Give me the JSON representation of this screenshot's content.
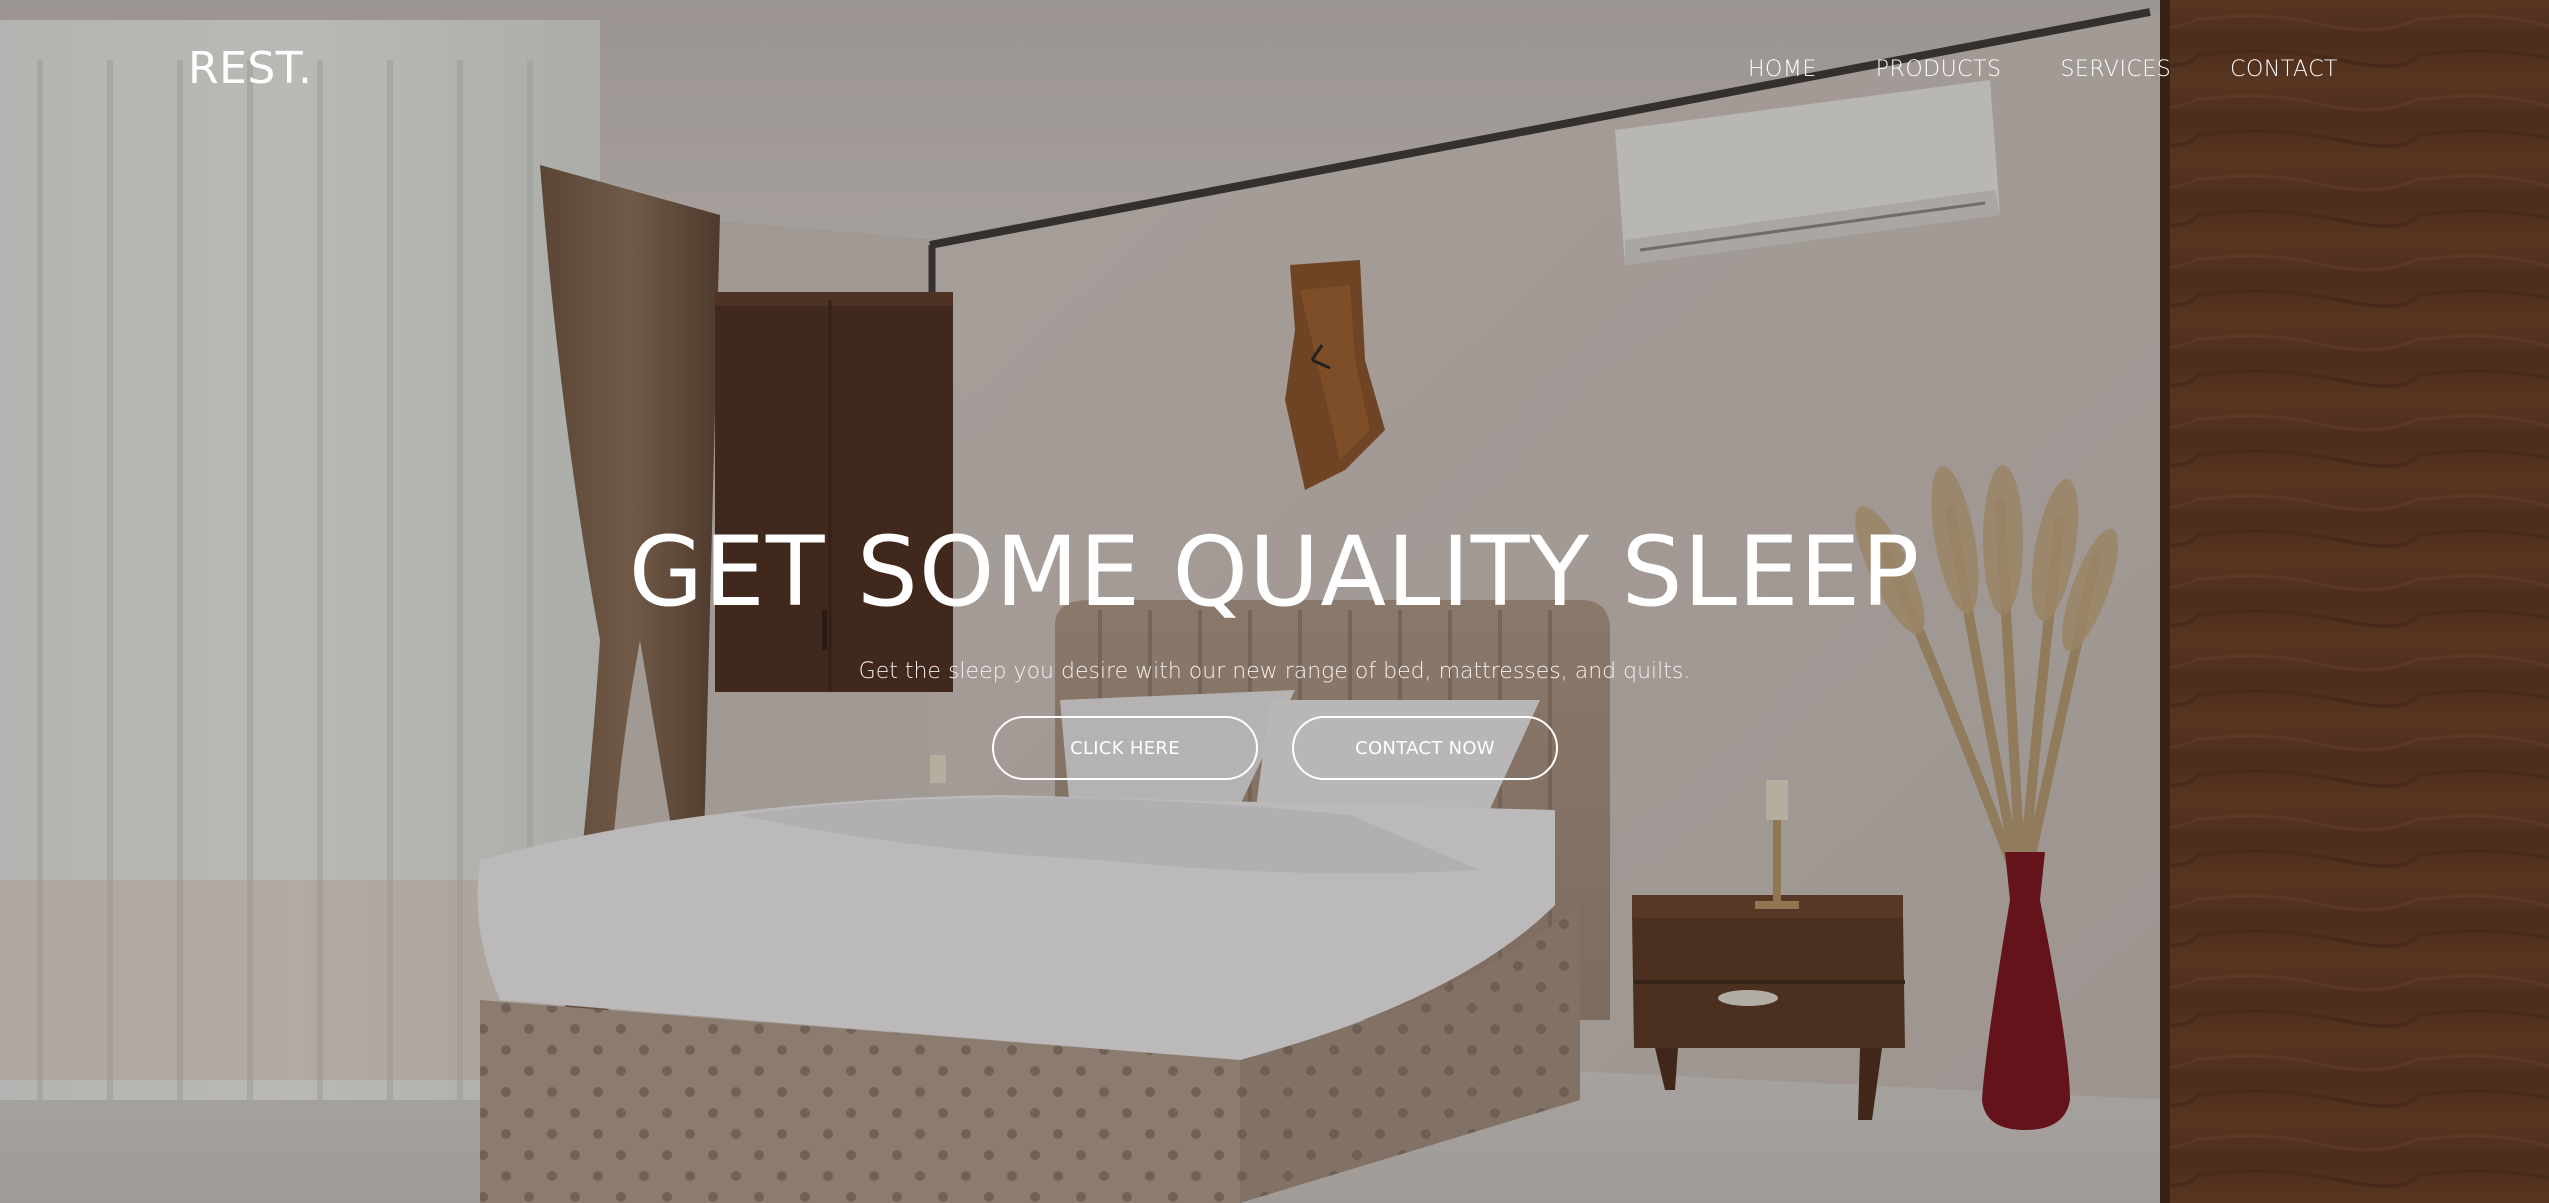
{
  "brand": {
    "logo": "REST."
  },
  "nav": {
    "items": [
      {
        "label": "HOME",
        "name": "nav-home"
      },
      {
        "label": "PRODUCTS",
        "name": "nav-products"
      },
      {
        "label": "SERVICES",
        "name": "nav-services"
      },
      {
        "label": "CONTACT",
        "name": "nav-contact"
      }
    ]
  },
  "hero": {
    "headline": "GET SOME QUALITY SLEEP",
    "subtext": "Get the sleep you desire with our new range of bed, mattresses, and quilts.",
    "primary_button": "CLICK HERE",
    "secondary_button": "CONTACT NOW"
  },
  "colors": {
    "text": "#ffffff",
    "overlay": "rgba(38,32,30,0.28)",
    "wall": "#d9d1cc",
    "wood": "#5a3520"
  }
}
